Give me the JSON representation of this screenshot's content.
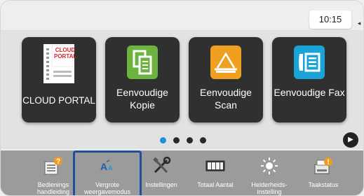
{
  "status": {
    "time": "10:15",
    "side_handle": "◂"
  },
  "tiles": [
    {
      "label": "CLOUD PORTAL",
      "icon": "cloud-portal-icon",
      "logo_text": "CLOUD PORTAL"
    },
    {
      "label": "Eenvoudige Kopie",
      "icon": "copy-icon"
    },
    {
      "label": "Eenvoudige Scan",
      "icon": "scan-icon"
    },
    {
      "label": "Eenvoudige Fax",
      "icon": "fax-icon"
    }
  ],
  "pager": {
    "pages": 4,
    "active": 0,
    "next_glyph": "▶"
  },
  "dock": [
    {
      "label": "Bedienings handleiding",
      "icon": "manual-help-icon"
    },
    {
      "label": "Vergrote weergavemodus",
      "icon": "enlarge-display-icon",
      "selected": true
    },
    {
      "label": "Instellingen",
      "icon": "settings-tools-icon"
    },
    {
      "label": "Totaal Aantal",
      "icon": "counter-icon"
    },
    {
      "label": "Helderheids-instelling",
      "icon": "brightness-icon"
    },
    {
      "label": "Taakstatus",
      "icon": "job-status-icon"
    }
  ],
  "colors": {
    "tile_bg": "#303030",
    "accent_blue": "#1f8fe0",
    "copy_green": "#6db33f",
    "scan_orange": "#f0a020",
    "fax_cyan": "#1aa3d9",
    "selection_border": "#1d4f9a"
  }
}
